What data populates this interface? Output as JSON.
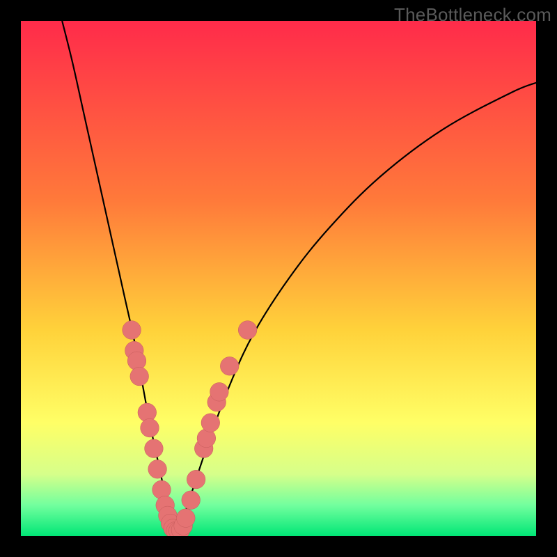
{
  "watermark": "TheBottleneck.com",
  "colors": {
    "bg": "#000000",
    "grad_top": "#ff2b4a",
    "grad_mid1": "#ff7a3a",
    "grad_mid2": "#ffd23a",
    "grad_mid3": "#ffff66",
    "grad_low1": "#d6ff8a",
    "grad_low2": "#72ff9e",
    "grad_bottom": "#00e676",
    "curve": "#000000",
    "marker_fill": "#e57373",
    "marker_stroke": "#c55b5b"
  },
  "chart_data": {
    "type": "line",
    "title": "",
    "xlabel": "",
    "ylabel": "",
    "xlim": [
      0,
      100
    ],
    "ylim": [
      0,
      100
    ],
    "curve_left": {
      "x": [
        8,
        10,
        12,
        14,
        16,
        18,
        20,
        22,
        23.5,
        25,
        26.5,
        28,
        29,
        30
      ],
      "y": [
        100,
        92,
        83,
        74,
        65,
        56,
        47,
        38,
        30,
        22,
        15,
        8,
        3,
        0
      ]
    },
    "curve_right": {
      "x": [
        30,
        31,
        33,
        36,
        40,
        45,
        52,
        60,
        70,
        82,
        95,
        100
      ],
      "y": [
        0,
        2,
        8,
        17,
        28,
        39,
        50,
        60,
        70,
        79,
        86,
        88
      ]
    },
    "markers": [
      {
        "x": 21.5,
        "y": 40,
        "r": 1.5
      },
      {
        "x": 22.0,
        "y": 36,
        "r": 1.5
      },
      {
        "x": 22.5,
        "y": 34,
        "r": 1.5
      },
      {
        "x": 23.0,
        "y": 31,
        "r": 1.5
      },
      {
        "x": 24.5,
        "y": 24,
        "r": 1.5
      },
      {
        "x": 25.0,
        "y": 21,
        "r": 1.5
      },
      {
        "x": 25.8,
        "y": 17,
        "r": 1.5
      },
      {
        "x": 26.5,
        "y": 13,
        "r": 1.5
      },
      {
        "x": 27.3,
        "y": 9,
        "r": 1.5
      },
      {
        "x": 28.0,
        "y": 6,
        "r": 1.5
      },
      {
        "x": 28.5,
        "y": 4,
        "r": 1.5
      },
      {
        "x": 29.0,
        "y": 2.5,
        "r": 1.5
      },
      {
        "x": 29.5,
        "y": 1.5,
        "r": 1.5
      },
      {
        "x": 30.0,
        "y": 1.0,
        "r": 1.5
      },
      {
        "x": 30.5,
        "y": 1.0,
        "r": 1.5
      },
      {
        "x": 31.0,
        "y": 1.2,
        "r": 1.5
      },
      {
        "x": 31.5,
        "y": 2.0,
        "r": 1.5
      },
      {
        "x": 32.0,
        "y": 3.5,
        "r": 1.5
      },
      {
        "x": 33.0,
        "y": 7,
        "r": 1.5
      },
      {
        "x": 34.0,
        "y": 11,
        "r": 1.5
      },
      {
        "x": 35.5,
        "y": 17,
        "r": 1.5
      },
      {
        "x": 36.0,
        "y": 19,
        "r": 1.5
      },
      {
        "x": 36.8,
        "y": 22,
        "r": 1.5
      },
      {
        "x": 38.0,
        "y": 26,
        "r": 1.5
      },
      {
        "x": 38.5,
        "y": 28,
        "r": 1.5
      },
      {
        "x": 40.5,
        "y": 33,
        "r": 1.5
      },
      {
        "x": 44.0,
        "y": 40,
        "r": 1.5
      }
    ],
    "gradient_stops": [
      {
        "offset": 0.0,
        "color_key": "grad_top"
      },
      {
        "offset": 0.35,
        "color_key": "grad_mid1"
      },
      {
        "offset": 0.6,
        "color_key": "grad_mid2"
      },
      {
        "offset": 0.78,
        "color_key": "grad_mid3"
      },
      {
        "offset": 0.88,
        "color_key": "grad_low1"
      },
      {
        "offset": 0.94,
        "color_key": "grad_low2"
      },
      {
        "offset": 1.0,
        "color_key": "grad_bottom"
      }
    ]
  }
}
